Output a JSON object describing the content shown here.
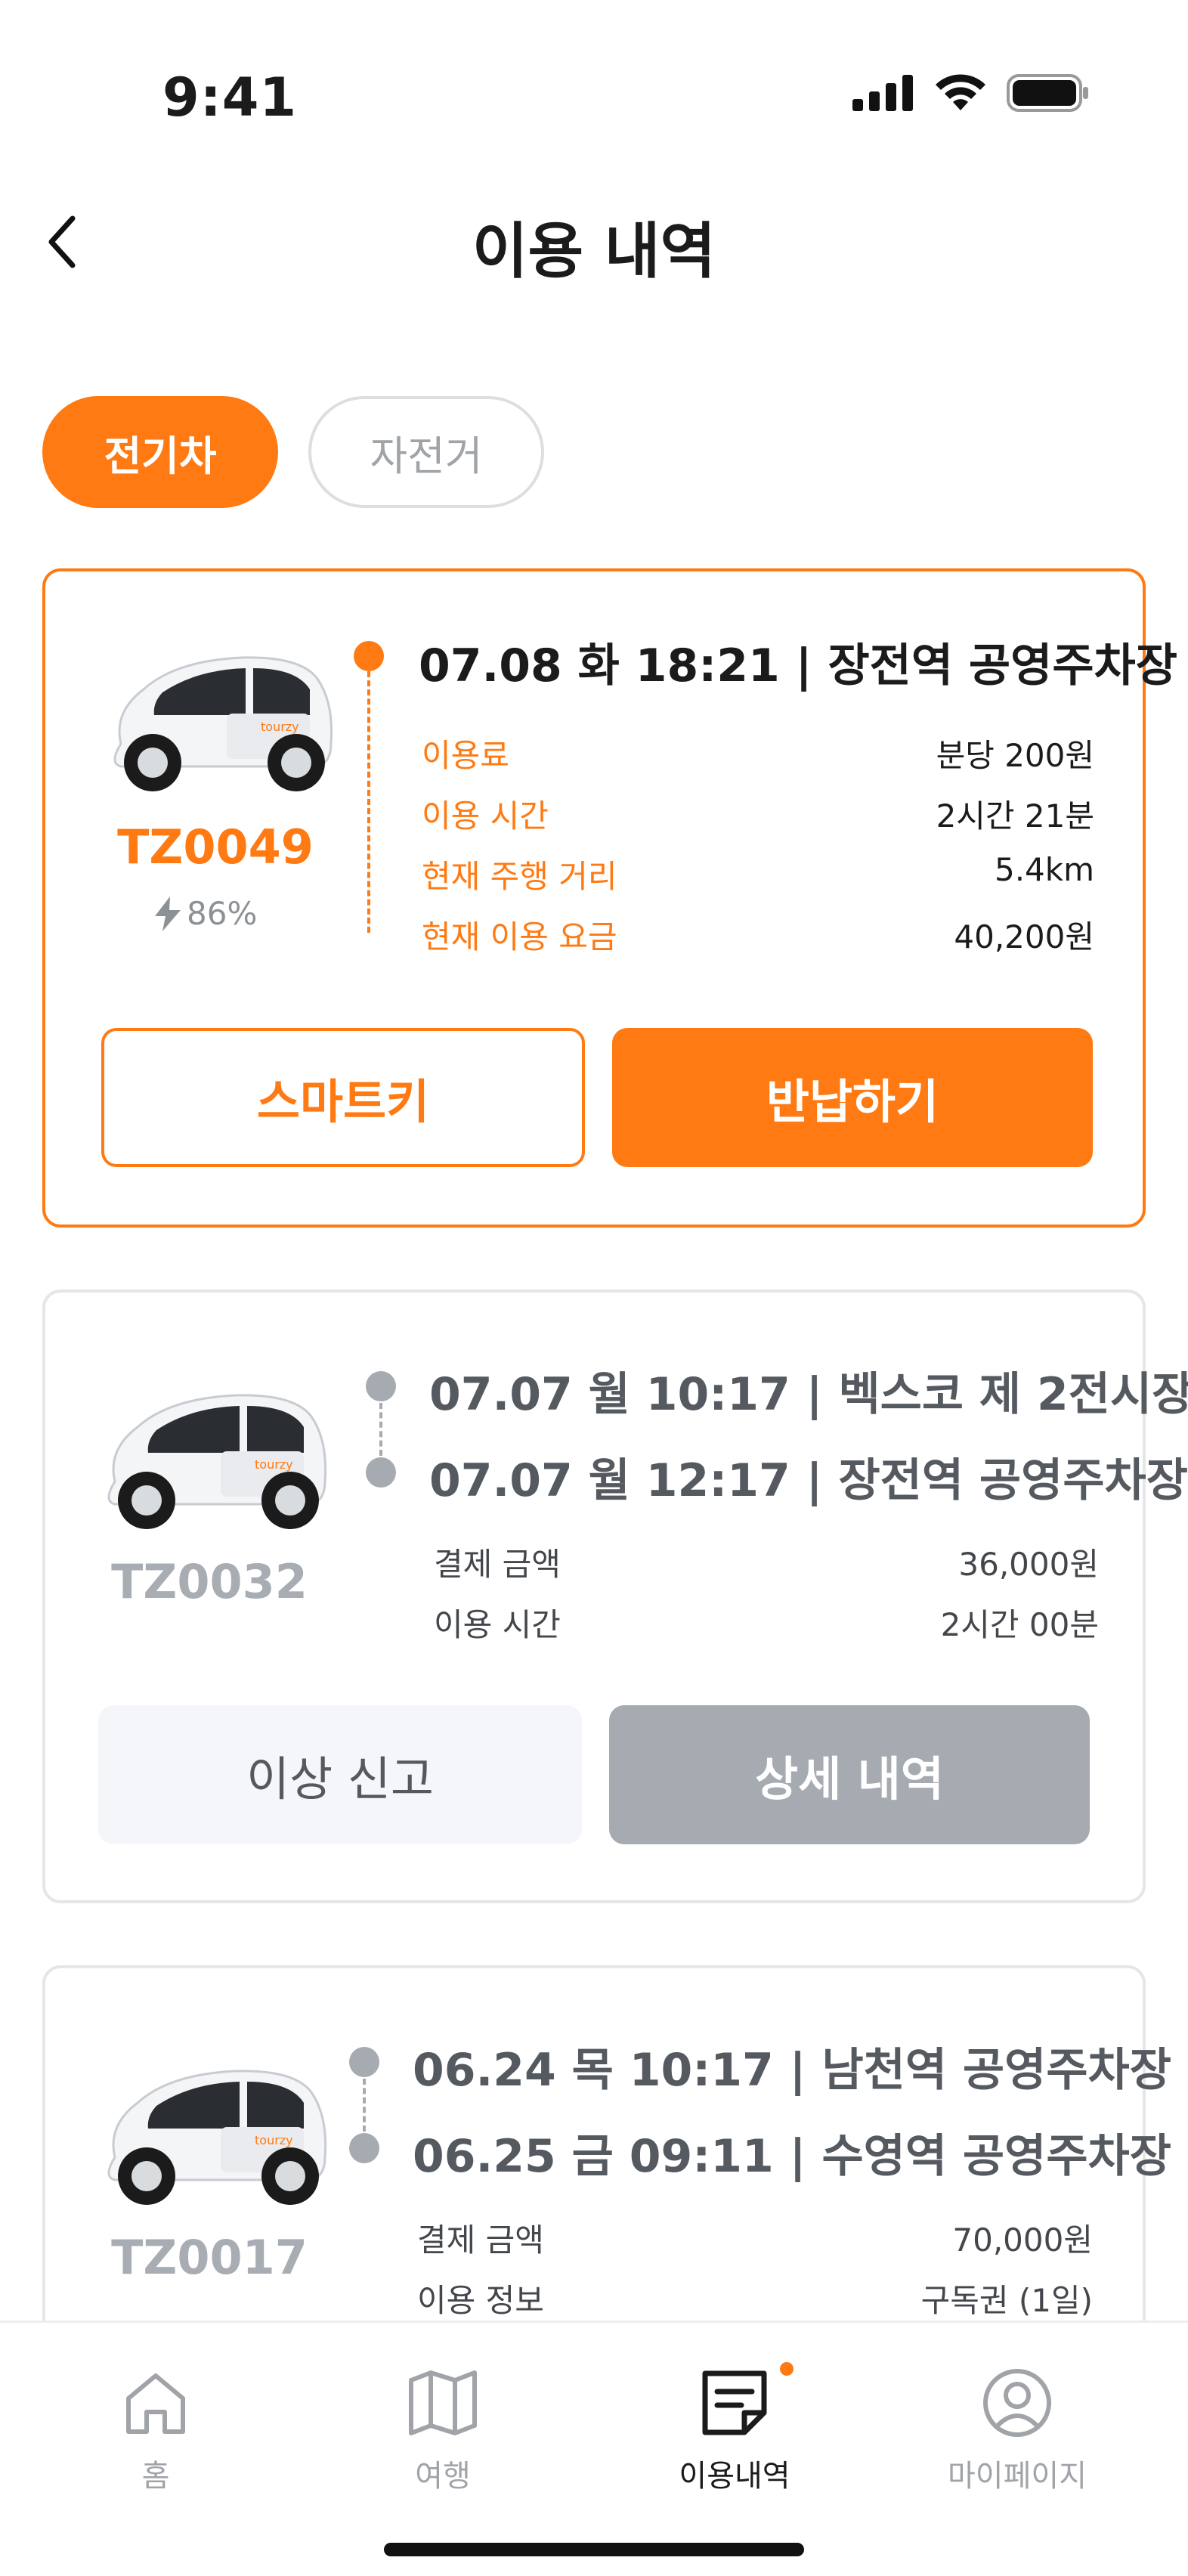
{
  "status_bar": {
    "time": "9:41",
    "icons": [
      "signal-icon",
      "wifi-icon",
      "battery-icon"
    ]
  },
  "header": {
    "title": "이용 내역",
    "back_icon": "chevron-left-icon"
  },
  "tabs": [
    {
      "label": "전기차",
      "selected": true
    },
    {
      "label": "자전거",
      "selected": false
    }
  ],
  "colors": {
    "accent": "#ff7a12",
    "muted": "#a5abb0",
    "text": "#1b1b1b"
  },
  "active_rental": {
    "vehicle_code": "TZ0049",
    "vehicle_logo_text": "tourzy",
    "battery": "86%",
    "trip_title": "07.08 화 18:21 | 장전역 공영주차장",
    "details": [
      {
        "label": "이용료",
        "value": "분당 200원"
      },
      {
        "label": "이용 시간",
        "value": "2시간 21분"
      },
      {
        "label": "현재 주행 거리",
        "value": "5.4km"
      },
      {
        "label": "현재 이용 요금",
        "value": "40,200원"
      }
    ],
    "buttons": {
      "smart_key": "스마트키",
      "return": "반납하기"
    }
  },
  "history": [
    {
      "vehicle_code": "TZ0032",
      "vehicle_logo_text": "tourzy",
      "start": "07.07 월 10:17 | 벡스코 제 2전시장",
      "end": "07.07 월 12:17 | 장전역 공영주차장",
      "details": [
        {
          "label": "결제 금액",
          "value": "36,000원"
        },
        {
          "label": "이용 시간",
          "value": "2시간 00분"
        }
      ],
      "buttons": {
        "report": "이상 신고",
        "detail": "상세 내역"
      }
    },
    {
      "vehicle_code": "TZ0017",
      "vehicle_logo_text": "tourzy",
      "start": "06.24 목 10:17 | 남천역 공영주차장",
      "end": "06.25 금 09:11 | 수영역 공영주차장",
      "details": [
        {
          "label": "결제 금액",
          "value": "70,000원"
        },
        {
          "label": "이용 정보",
          "value": "구독권 (1일)"
        }
      ]
    }
  ],
  "bottom_nav": [
    {
      "label": "홈",
      "icon": "home-icon",
      "active": false
    },
    {
      "label": "여행",
      "icon": "map-icon",
      "active": false
    },
    {
      "label": "이용내역",
      "icon": "receipt-icon",
      "active": true,
      "badge": true
    },
    {
      "label": "마이페이지",
      "icon": "profile-icon",
      "active": false
    }
  ]
}
